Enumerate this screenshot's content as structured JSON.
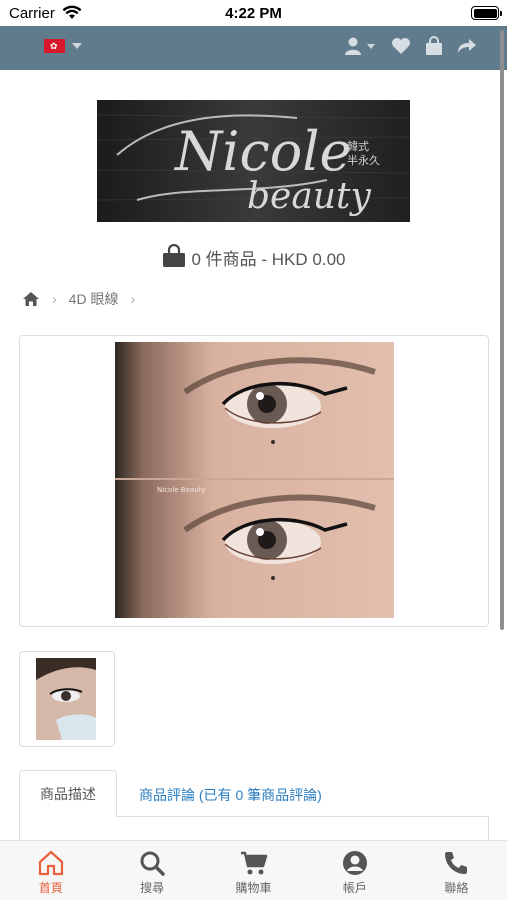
{
  "status_bar": {
    "carrier": "Carrier",
    "time": "4:22 PM"
  },
  "header": {
    "flag_icon": "hong-kong-flag",
    "icons": [
      "user-icon",
      "heart-icon",
      "shopping-bag-icon",
      "share-icon"
    ],
    "bar_color": "#5f7b8c"
  },
  "logo": {
    "main_text": "Nicole",
    "sub_text": "beauty",
    "side_text_1": "韓式",
    "side_text_2": "半永久"
  },
  "cart": {
    "summary": "0 件商品 - HKD 0.00"
  },
  "breadcrumb": {
    "items": [
      "4D 眼線"
    ]
  },
  "product": {
    "image_watermark": "Nicole Beauty",
    "thumbnail_count": 1
  },
  "tabs": [
    {
      "label": "商品描述",
      "active": true
    },
    {
      "label": "商品評論 (已有 0 筆商品評論)",
      "active": false
    }
  ],
  "bottom_nav": [
    {
      "label": "首頁",
      "icon": "home-icon",
      "active": true
    },
    {
      "label": "搜尋",
      "icon": "search-icon",
      "active": false
    },
    {
      "label": "購物車",
      "icon": "cart-icon",
      "active": false
    },
    {
      "label": "帳戶",
      "icon": "account-icon",
      "active": false
    },
    {
      "label": "聯絡",
      "icon": "phone-icon",
      "active": false
    }
  ],
  "colors": {
    "accent": "#e8603c",
    "link": "#2a7dc2"
  }
}
